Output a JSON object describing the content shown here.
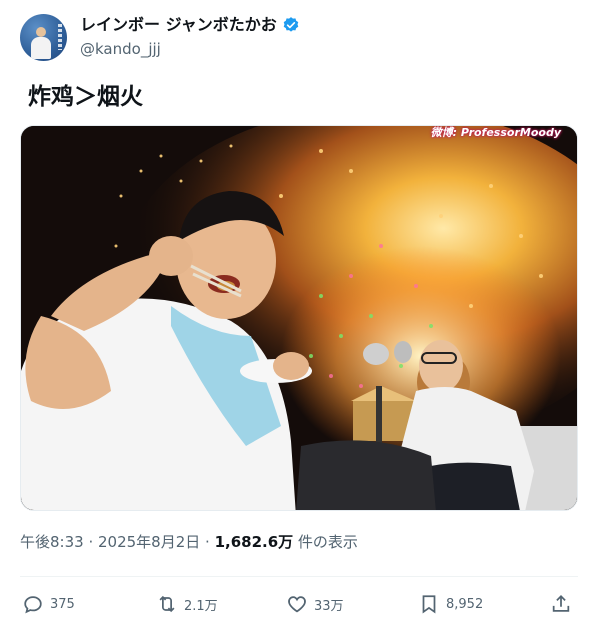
{
  "author": {
    "display_name": "レインボー ジャンボたかお",
    "handle": "@kando_jjj",
    "verified": true,
    "verified_color": "#1d9bf0"
  },
  "tweet": {
    "text": "炸鸡＞烟火",
    "watermark": "微博: ProfessorMoody",
    "timestamp": "午後8:33 · 2025年8月2日 · ",
    "views_value": "1,682.6万",
    "views_label": " 件の表示"
  },
  "actions": {
    "replies": "375",
    "reposts": "2.1万",
    "likes": "33万",
    "bookmarks": "8,952"
  },
  "icons": [
    "verified-badge-icon",
    "reply-icon",
    "repost-icon",
    "like-icon",
    "bookmark-icon",
    "share-icon"
  ]
}
